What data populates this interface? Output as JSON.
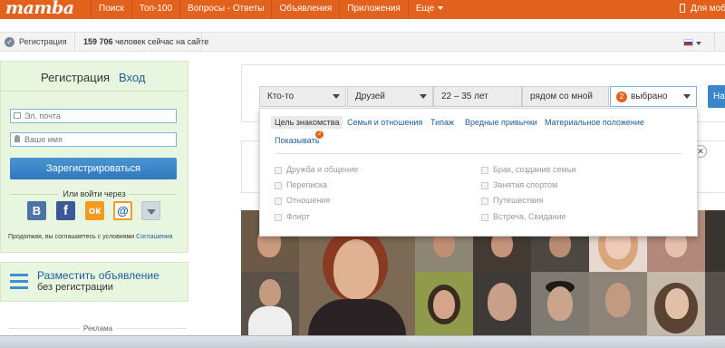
{
  "header": {
    "logo": "mamba",
    "nav": [
      "Поиск",
      "Топ-100",
      "Вопросы - Ответы",
      "Объявления",
      "Приложения",
      "Еще"
    ],
    "mobile": "Для моби"
  },
  "subbar": {
    "registration": "Регистрация",
    "online_count": "159 706",
    "online_text": "человек сейчас на сайте"
  },
  "registration": {
    "tab_register": "Регистрация",
    "tab_login": "Вход",
    "email_placeholder": "Эл. почта",
    "name_placeholder": "Ваше имя",
    "register_button": "Зарегистрироваться",
    "or_login": "Или войти через",
    "social": [
      {
        "label": "В",
        "icon": "vk-icon"
      },
      {
        "label": "f",
        "icon": "facebook-icon"
      },
      {
        "label": "ок",
        "icon": "odnoklassniki-icon"
      },
      {
        "label": "@",
        "icon": "mailru-icon"
      }
    ],
    "agreement_text": "Продолжая, вы соглашаетесь с условиями",
    "agreement_link": "Соглашения"
  },
  "ad_block": {
    "title": "Разместить объявление",
    "subtitle": "без регистрации"
  },
  "advert_label": "Реклама",
  "search": {
    "who": "Кто-то",
    "goal": "Друзей",
    "age_from": "22",
    "age_dash": "–",
    "age_to": "35",
    "age_unit": "лет",
    "location": "рядом со мной",
    "chosen_count": "2",
    "chosen_label": "выбрано",
    "find_button": "Най"
  },
  "dropdown": {
    "tabs": [
      "Цель знакомства",
      "Семья и отношения",
      "Типаж",
      "Вредные привычки",
      "Материальное положение"
    ],
    "show_label": "Показывать",
    "show_badge": "2",
    "options_left": [
      "Дружба и общение",
      "Переписка",
      "Отношения",
      "Флирт"
    ],
    "options_right": [
      "Брак, создание семьи",
      "Занятия спортом",
      "Путешествия",
      "Встреча, Свидание"
    ]
  },
  "colors": {
    "brand": "#e2611c",
    "link": "#1a5e9a",
    "panel": "#e9f6df",
    "button": "#3a86c8"
  }
}
